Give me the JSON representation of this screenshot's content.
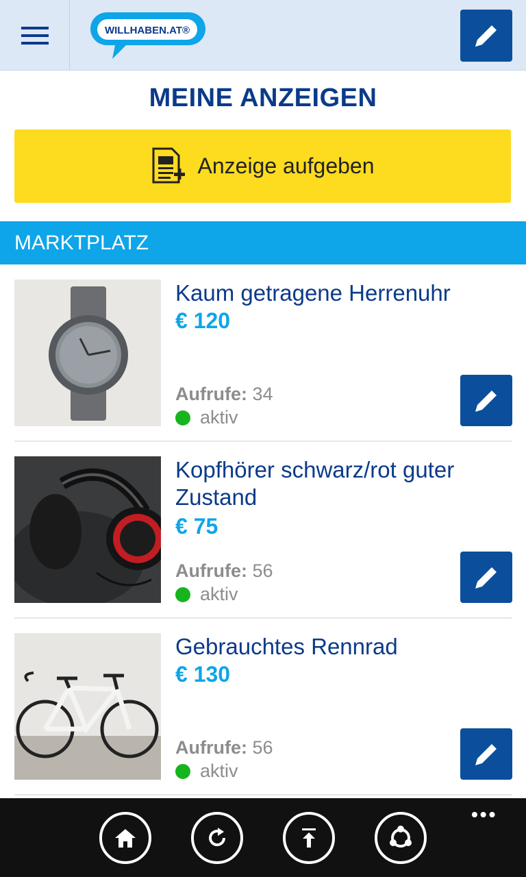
{
  "header": {
    "menu_icon": "hamburger-menu-icon",
    "logo_text": "WILLHABEN.AT®",
    "edit_icon": "pencil-icon"
  },
  "page": {
    "title": "MEINE ANZEIGEN",
    "cta_label": "Anzeige aufgeben",
    "cta_icon": "document-add-icon"
  },
  "section": {
    "title": "MARKTPLATZ"
  },
  "listings": [
    {
      "title": "Kaum getragene Herrenuhr",
      "price": "€ 120",
      "views_label": "Aufrufe:",
      "views": "34",
      "status": "aktiv",
      "image": "wristwatch-photo"
    },
    {
      "title": "Kopfhörer schwarz/rot guter Zustand",
      "price": "€ 75",
      "views_label": "Aufrufe:",
      "views": "56",
      "status": "aktiv",
      "image": "headphones-photo"
    },
    {
      "title": "Gebrauchtes Rennrad",
      "price": "€ 130",
      "views_label": "Aufrufe:",
      "views": "56",
      "status": "aktiv",
      "image": "road-bike-photo"
    }
  ],
  "colors": {
    "brand_blue": "#0b4f9c",
    "title_blue": "#0b3a8a",
    "accent_cyan": "#0ea5e9",
    "cta_yellow": "#fddb1f",
    "status_green": "#18b41e"
  },
  "appbar": {
    "buttons": [
      "home-icon",
      "refresh-icon",
      "upload-icon",
      "share-icon"
    ],
    "more_label": "•••"
  }
}
